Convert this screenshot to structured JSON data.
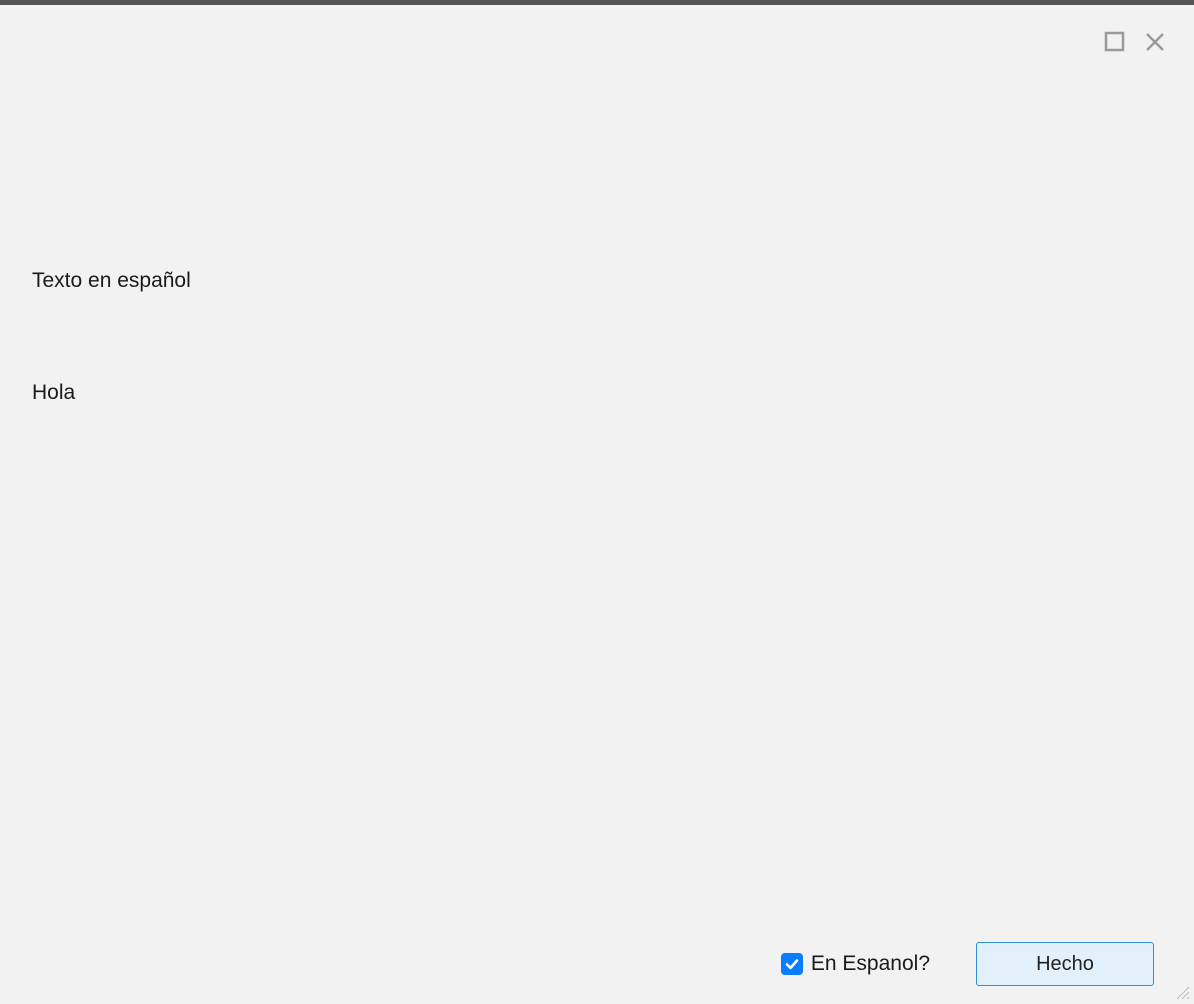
{
  "controls": {
    "maximize_name": "maximize-icon",
    "close_name": "close-icon"
  },
  "content": {
    "line1": "Texto en español",
    "line2": "Hola"
  },
  "footer": {
    "checkbox_checked": true,
    "checkbox_label": "En Espanol?",
    "done_label": "Hecho"
  }
}
